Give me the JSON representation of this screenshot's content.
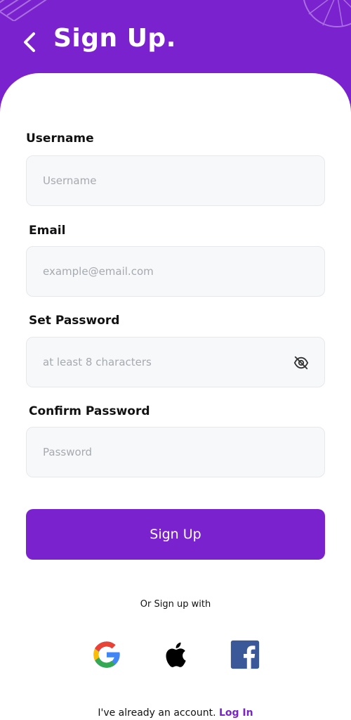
{
  "header": {
    "title": "Sign Up."
  },
  "form": {
    "username": {
      "label": "Username",
      "placeholder": "Username"
    },
    "email": {
      "label": "Email",
      "placeholder": "example@email.com"
    },
    "password": {
      "label": "Set Password",
      "placeholder": "at least 8 characters"
    },
    "confirm": {
      "label": "Confirm  Password",
      "placeholder": "Password"
    }
  },
  "actions": {
    "signup_label": "Sign Up"
  },
  "social": {
    "prompt": "Or Sign up with",
    "providers": [
      {
        "name": "google-icon"
      },
      {
        "name": "apple-icon"
      },
      {
        "name": "facebook-icon"
      }
    ]
  },
  "footer": {
    "text": "I've already an account.",
    "link": "Log In"
  },
  "colors": {
    "brand": "#7b22cf",
    "field_bg": "#f7f8fa",
    "field_border": "#e6e8ec"
  }
}
